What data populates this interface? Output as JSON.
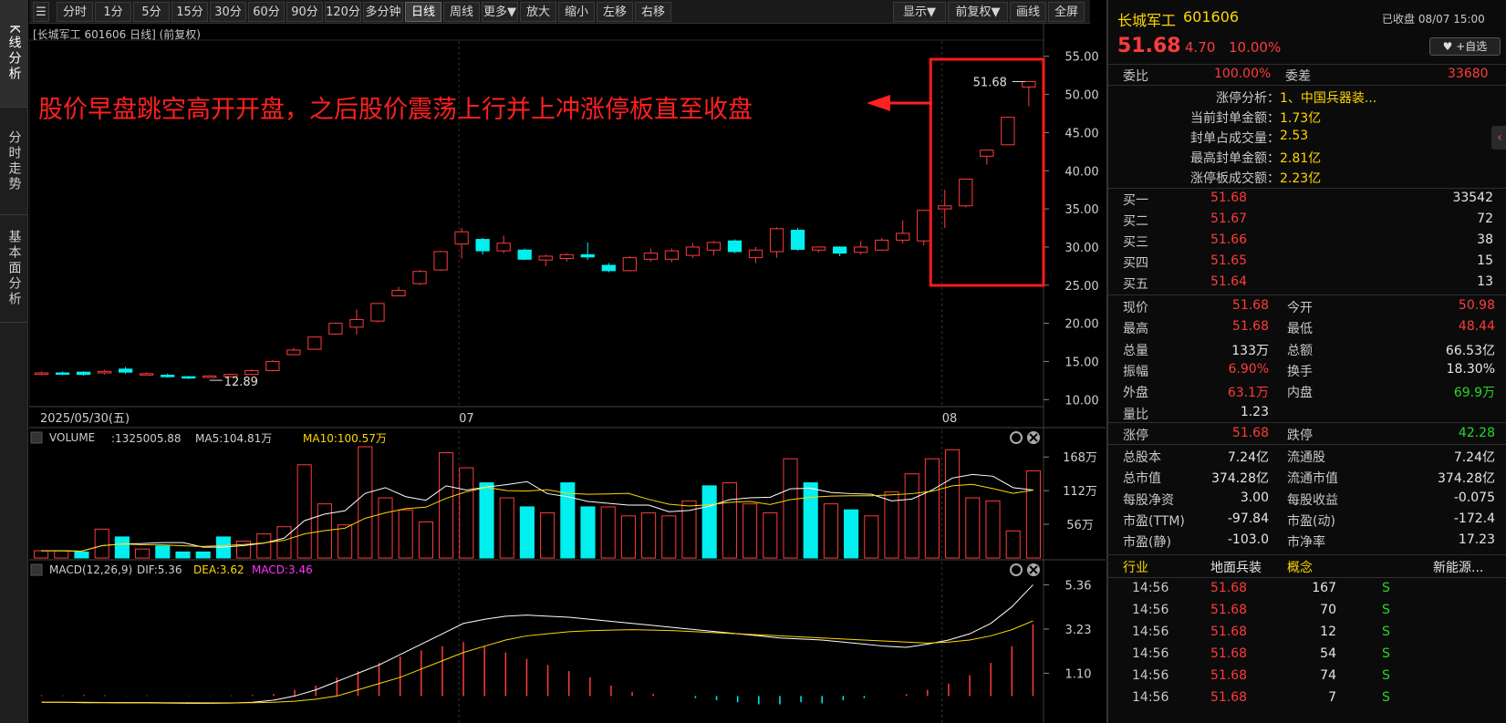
{
  "left_tabs": [
    "K线分析",
    "分时走势",
    "基本面分析"
  ],
  "toolbar": {
    "left": [
      "分时",
      "1分",
      "5分",
      "15分",
      "30分",
      "60分",
      "90分",
      "120分",
      "多分钟",
      "日线",
      "周线",
      "更多▼",
      "放大",
      "缩小",
      "左移",
      "右移"
    ],
    "active": "日线",
    "right": [
      "显示▼",
      "前复权▼",
      "画线",
      "全屏"
    ]
  },
  "chart_header": "[长城军工 601606 日线] (前复权)",
  "annotation": "股价早盘跳空高开开盘，之后股价震荡上行并上冲涨停板直至收盘",
  "chart_data": [
    {
      "type": "candlestick",
      "y_ticks": [
        "55.00",
        "50.00",
        "45.00",
        "40.00",
        "35.00",
        "30.00",
        "25.00",
        "20.00",
        "15.00",
        "10.00"
      ],
      "ylim": [
        9.2,
        57
      ],
      "x_labels": [
        "2025/05/30(五)",
        "07",
        "08"
      ],
      "low_label": "12.89",
      "high_label": "51.68",
      "candles": [
        {
          "o": 13.3,
          "c": 13.5,
          "h": 13.7,
          "l": 13.2
        },
        {
          "o": 13.5,
          "c": 13.4,
          "h": 13.7,
          "l": 13.2
        },
        {
          "o": 13.6,
          "c": 13.3,
          "h": 13.7,
          "l": 13.1
        },
        {
          "o": 13.5,
          "c": 13.7,
          "h": 13.9,
          "l": 13.3
        },
        {
          "o": 14.0,
          "c": 13.6,
          "h": 14.3,
          "l": 13.4
        },
        {
          "o": 13.3,
          "c": 13.4,
          "h": 13.6,
          "l": 13.2
        },
        {
          "o": 13.2,
          "c": 13.0,
          "h": 13.4,
          "l": 12.9
        },
        {
          "o": 13.0,
          "c": 12.9,
          "h": 13.1,
          "l": 12.7
        },
        {
          "o": 12.9,
          "c": 13.1,
          "h": 13.2,
          "l": 12.89
        },
        {
          "o": 13.0,
          "c": 13.3,
          "h": 13.4,
          "l": 12.9
        },
        {
          "o": 13.3,
          "c": 13.8,
          "h": 14.0,
          "l": 13.2
        },
        {
          "o": 13.8,
          "c": 15.0,
          "h": 15.2,
          "l": 13.7
        },
        {
          "o": 15.9,
          "c": 16.5,
          "h": 16.8,
          "l": 15.8
        },
        {
          "o": 16.6,
          "c": 18.2,
          "h": 18.2,
          "l": 16.5
        },
        {
          "o": 18.6,
          "c": 20.0,
          "h": 20.1,
          "l": 18.5
        },
        {
          "o": 19.5,
          "c": 20.5,
          "h": 21.8,
          "l": 18.5
        },
        {
          "o": 20.3,
          "c": 22.6,
          "h": 22.6,
          "l": 20.1
        },
        {
          "o": 23.6,
          "c": 24.3,
          "h": 24.8,
          "l": 23.6
        },
        {
          "o": 25.2,
          "c": 26.8,
          "h": 27.0,
          "l": 25.0
        },
        {
          "o": 27.0,
          "c": 29.4,
          "h": 29.5,
          "l": 26.9
        },
        {
          "o": 30.4,
          "c": 32.0,
          "h": 32.5,
          "l": 28.5
        },
        {
          "o": 31.0,
          "c": 29.5,
          "h": 31.2,
          "l": 29.0
        },
        {
          "o": 29.5,
          "c": 30.5,
          "h": 31.5,
          "l": 29.2
        },
        {
          "o": 29.6,
          "c": 28.4,
          "h": 29.8,
          "l": 28.3
        },
        {
          "o": 28.3,
          "c": 28.8,
          "h": 29.0,
          "l": 27.5
        },
        {
          "o": 28.5,
          "c": 29.0,
          "h": 29.2,
          "l": 28.1
        },
        {
          "o": 29.0,
          "c": 28.7,
          "h": 30.6,
          "l": 28.3
        },
        {
          "o": 27.6,
          "c": 26.9,
          "h": 27.9,
          "l": 26.7
        },
        {
          "o": 26.9,
          "c": 28.6,
          "h": 28.8,
          "l": 26.8
        },
        {
          "o": 28.4,
          "c": 29.2,
          "h": 29.8,
          "l": 28.1
        },
        {
          "o": 28.4,
          "c": 29.5,
          "h": 29.8,
          "l": 28.0
        },
        {
          "o": 28.9,
          "c": 30.0,
          "h": 30.5,
          "l": 28.6
        },
        {
          "o": 29.6,
          "c": 30.6,
          "h": 30.8,
          "l": 28.9
        },
        {
          "o": 30.8,
          "c": 29.4,
          "h": 31.0,
          "l": 29.2
        },
        {
          "o": 28.6,
          "c": 29.6,
          "h": 30.0,
          "l": 27.9
        },
        {
          "o": 29.4,
          "c": 32.4,
          "h": 32.6,
          "l": 28.6
        },
        {
          "o": 32.2,
          "c": 29.7,
          "h": 32.5,
          "l": 29.5
        },
        {
          "o": 29.6,
          "c": 30.0,
          "h": 30.1,
          "l": 29.3
        },
        {
          "o": 30.0,
          "c": 29.2,
          "h": 30.1,
          "l": 28.8
        },
        {
          "o": 29.3,
          "c": 30.0,
          "h": 30.8,
          "l": 29.0
        },
        {
          "o": 29.6,
          "c": 30.9,
          "h": 31.2,
          "l": 29.5
        },
        {
          "o": 30.9,
          "c": 31.8,
          "h": 33.5,
          "l": 30.5
        },
        {
          "o": 30.8,
          "c": 34.8,
          "h": 34.9,
          "l": 30.2
        },
        {
          "o": 35.0,
          "c": 35.4,
          "h": 37.5,
          "l": 32.5
        },
        {
          "o": 35.4,
          "c": 38.9,
          "h": 39.0,
          "l": 35.2
        },
        {
          "o": 41.9,
          "c": 42.7,
          "h": 42.8,
          "l": 40.8
        },
        {
          "o": 43.4,
          "c": 47.0,
          "h": 47.0,
          "l": 43.3
        },
        {
          "o": 50.98,
          "c": 51.68,
          "h": 51.68,
          "l": 48.44
        }
      ]
    },
    {
      "type": "bar",
      "title": "VOLUME",
      "legend": [
        {
          "text": ":1325005.88",
          "color": "#cfcfcf"
        },
        {
          "text": "MA5:104.81万",
          "color": "#cfcfcf"
        },
        {
          "text": "MA10:100.57万",
          "color": "#ffd700"
        }
      ],
      "y_ticks": [
        "168万",
        "112万",
        "56万"
      ],
      "ylim": [
        0,
        185
      ],
      "values": [
        12,
        12,
        10,
        48,
        35,
        15,
        20,
        10,
        10,
        35,
        28,
        40,
        52,
        155,
        90,
        55,
        185,
        100,
        80,
        60,
        175,
        150,
        125,
        100,
        85,
        75,
        125,
        85,
        85,
        70,
        75,
        70,
        95,
        120,
        125,
        90,
        75,
        165,
        125,
        90,
        80,
        70,
        110,
        140,
        165,
        180,
        100,
        95,
        45,
        145
      ],
      "down": [
        false,
        false,
        true,
        false,
        true,
        false,
        true,
        true,
        true,
        true,
        false,
        false,
        false,
        false,
        false,
        false,
        false,
        false,
        false,
        false,
        false,
        false,
        true,
        false,
        true,
        false,
        true,
        true,
        false,
        false,
        false,
        false,
        false,
        true,
        false,
        false,
        false,
        false,
        true,
        false,
        true,
        false,
        false,
        false,
        false,
        false,
        false,
        false,
        false,
        false
      ]
    },
    {
      "type": "bar",
      "title": "MACD(12,26,9)",
      "legend": [
        {
          "text": "DIF:5.36",
          "color": "#cfcfcf"
        },
        {
          "text": "DEA:3.62",
          "color": "#ffd700"
        },
        {
          "text": "MACD:3.46",
          "color": "#ff33ff"
        }
      ],
      "y_ticks": [
        "5.36",
        "3.23",
        "1.10"
      ],
      "ylim": [
        -1.3,
        5.6
      ],
      "values": [
        0.04,
        0.03,
        0.05,
        0.04,
        0.02,
        0.03,
        0.01,
        0.02,
        0.02,
        0.03,
        0.05,
        0.1,
        0.3,
        0.5,
        0.9,
        1.2,
        1.6,
        1.9,
        2.2,
        2.4,
        2.6,
        2.4,
        2.1,
        1.8,
        1.5,
        1.2,
        0.9,
        0.5,
        0.2,
        0.1,
        0.0,
        -0.1,
        -0.2,
        -0.3,
        -0.4,
        -0.4,
        -0.3,
        -0.35,
        -0.2,
        -0.1,
        0.0,
        0.1,
        0.3,
        0.6,
        1.0,
        1.6,
        2.4,
        3.46
      ],
      "dif": [
        -0.3,
        -0.3,
        -0.32,
        -0.32,
        -0.33,
        -0.33,
        -0.34,
        -0.35,
        -0.35,
        -0.34,
        -0.3,
        -0.2,
        0.0,
        0.3,
        0.7,
        1.1,
        1.5,
        2.0,
        2.5,
        3.0,
        3.5,
        3.7,
        3.85,
        3.9,
        3.85,
        3.8,
        3.7,
        3.6,
        3.5,
        3.4,
        3.3,
        3.2,
        3.1,
        3.0,
        2.9,
        2.8,
        2.75,
        2.7,
        2.6,
        2.5,
        2.4,
        2.35,
        2.5,
        2.7,
        3.0,
        3.5,
        4.3,
        5.36
      ],
      "dea": [
        -0.3,
        -0.3,
        -0.3,
        -0.31,
        -0.31,
        -0.31,
        -0.32,
        -0.32,
        -0.33,
        -0.33,
        -0.32,
        -0.3,
        -0.25,
        -0.15,
        0.0,
        0.3,
        0.6,
        0.9,
        1.3,
        1.7,
        2.1,
        2.4,
        2.7,
        2.9,
        3.0,
        3.1,
        3.15,
        3.18,
        3.2,
        3.18,
        3.15,
        3.1,
        3.05,
        3.0,
        2.95,
        2.9,
        2.85,
        2.8,
        2.75,
        2.7,
        2.65,
        2.6,
        2.55,
        2.6,
        2.7,
        2.9,
        3.2,
        3.62
      ]
    }
  ],
  "quote": {
    "name": "长城军工",
    "code": "601606",
    "status": "已收盘 08/07 15:00",
    "price": "51.68",
    "change": "4.70",
    "pct": "10.00%",
    "fav": "♥ +自选",
    "webi_label": "委比",
    "webi": "100.00%",
    "weicha_label": "委差",
    "weicha": "33680"
  },
  "limit_up": [
    {
      "label": "涨停分析：",
      "value": "1、中国兵器装..."
    },
    {
      "label": "当前封单金额：",
      "value": "1.73亿"
    },
    {
      "label": "封单占成交量：",
      "value": "2.53"
    },
    {
      "label": "最高封单金额：",
      "value": "2.81亿"
    },
    {
      "label": "涨停板成交额：",
      "value": "2.23亿"
    }
  ],
  "bids": [
    {
      "label": "买一",
      "price": "51.68",
      "vol": "33542"
    },
    {
      "label": "买二",
      "price": "51.67",
      "vol": "72"
    },
    {
      "label": "买三",
      "price": "51.66",
      "vol": "38"
    },
    {
      "label": "买四",
      "price": "51.65",
      "vol": "15"
    },
    {
      "label": "买五",
      "price": "51.64",
      "vol": "13"
    }
  ],
  "stats1": [
    {
      "l1": "现价",
      "v1": "51.68",
      "c1": "red",
      "l2": "今开",
      "v2": "50.98",
      "c2": "red"
    },
    {
      "l1": "最高",
      "v1": "51.68",
      "c1": "red",
      "l2": "最低",
      "v2": "48.44",
      "c2": "red"
    },
    {
      "l1": "总量",
      "v1": "133万",
      "c1": "white",
      "l2": "总额",
      "v2": "66.53亿",
      "c2": "white"
    },
    {
      "l1": "振幅",
      "v1": "6.90%",
      "c1": "red",
      "l2": "换手",
      "v2": "18.30%",
      "c2": "white"
    },
    {
      "l1": "外盘",
      "v1": "63.1万",
      "c1": "red",
      "l2": "内盘",
      "v2": "69.9万",
      "c2": "green"
    },
    {
      "l1": "量比",
      "v1": "1.23",
      "c1": "white",
      "l2": "",
      "v2": "",
      "c2": "white"
    }
  ],
  "stats2": [
    {
      "l1": "涨停",
      "v1": "51.68",
      "c1": "red",
      "l2": "跌停",
      "v2": "42.28",
      "c2": "green"
    }
  ],
  "stats3": [
    {
      "l1": "总股本",
      "v1": "7.24亿",
      "c1": "white",
      "l2": "流通股",
      "v2": "7.24亿",
      "c2": "white"
    },
    {
      "l1": "总市值",
      "v1": "374.28亿",
      "c1": "white",
      "l2": "流通市值",
      "v2": "374.28亿",
      "c2": "white"
    },
    {
      "l1": "每股净资",
      "v1": "3.00",
      "c1": "white",
      "l2": "每股收益",
      "v2": "-0.075",
      "c2": "white"
    },
    {
      "l1": "市盈(TTM)",
      "v1": "-97.84",
      "c1": "white",
      "l2": "市盈(动)",
      "v2": "-172.4",
      "c2": "white"
    },
    {
      "l1": "市盈(静)",
      "v1": "-103.0",
      "c1": "white",
      "l2": "市净率",
      "v2": "17.23",
      "c2": "white"
    }
  ],
  "industry": {
    "label": "行业",
    "value": "地面兵装",
    "concept_label": "概念",
    "concept": "新能源..."
  },
  "ticks": [
    {
      "time": "14:56",
      "price": "51.68",
      "vol": "167",
      "dir": "S"
    },
    {
      "time": "14:56",
      "price": "51.68",
      "vol": "70",
      "dir": "S"
    },
    {
      "time": "14:56",
      "price": "51.68",
      "vol": "12",
      "dir": "S"
    },
    {
      "time": "14:56",
      "price": "51.68",
      "vol": "54",
      "dir": "S"
    },
    {
      "time": "14:56",
      "price": "51.68",
      "vol": "74",
      "dir": "S"
    },
    {
      "time": "14:56",
      "price": "51.68",
      "vol": "7",
      "dir": "S"
    }
  ],
  "colors": {
    "up": "#ff3b3b",
    "down": "#00f0f0",
    "box": "#ff1a1a",
    "ma5": "#ffffff",
    "ma10": "#ffd700"
  }
}
